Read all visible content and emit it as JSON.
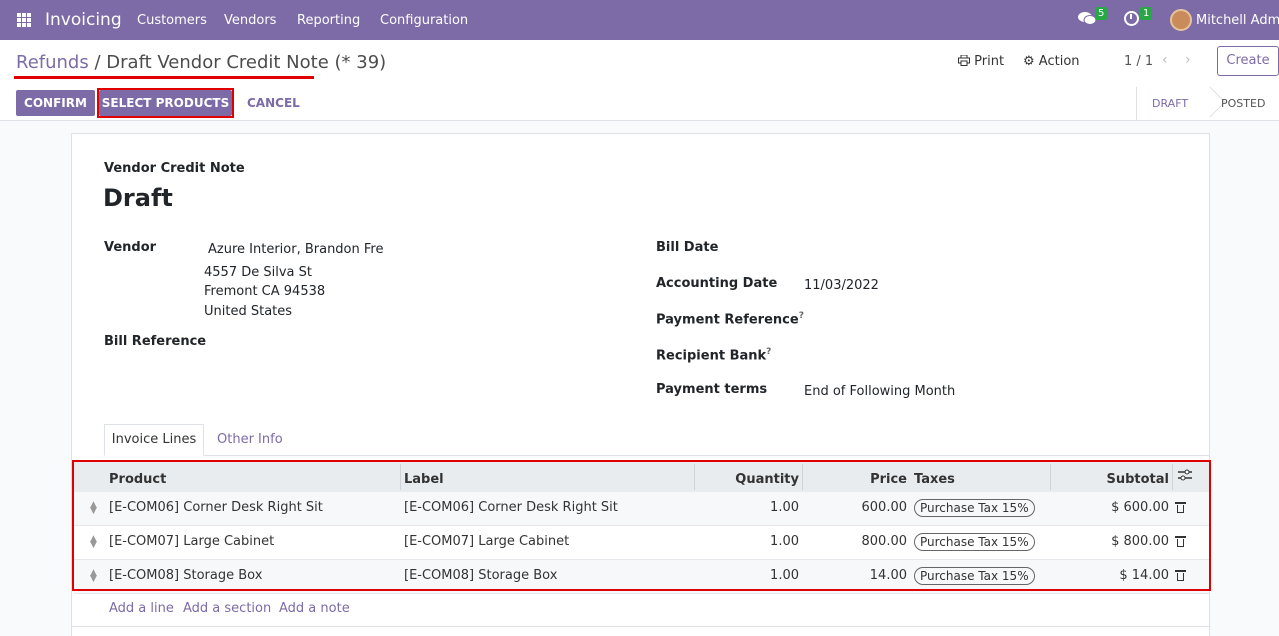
{
  "navbar": {
    "app_name": "Invoicing",
    "menu": [
      "Customers",
      "Vendors",
      "Reporting",
      "Configuration"
    ],
    "messages_count": "5",
    "activities_count": "1",
    "user_name": "Mitchell Admin"
  },
  "control_panel": {
    "breadcrumb_parent": "Refunds",
    "breadcrumb_separator": "/",
    "breadcrumb_current": "Draft Vendor Credit Note (* 39)",
    "print_label": "Print",
    "action_label": "Action",
    "pager": "1 / 1",
    "create_label": "Create",
    "confirm_label": "CONFIRM",
    "select_products_label": "SELECT PRODUCTS",
    "cancel_label": "CANCEL",
    "statuses": [
      "DRAFT",
      "POSTED"
    ]
  },
  "form": {
    "doc_type": "Vendor Credit Note",
    "doc_name": "Draft",
    "vendor_label": "Vendor",
    "vendor_name": "Azure Interior, Brandon Fre",
    "vendor_address": [
      "4557 De Silva St",
      "Fremont CA 94538",
      "United States"
    ],
    "bill_reference_label": "Bill Reference",
    "bill_date_label": "Bill Date",
    "bill_date_value": "",
    "accounting_date_label": "Accounting Date",
    "accounting_date_value": "11/03/2022",
    "payment_reference_label": "Payment Reference",
    "recipient_bank_label": "Recipient Bank",
    "help_mark": "?",
    "payment_terms_label": "Payment terms",
    "payment_terms_value": "End of Following Month"
  },
  "tabs": [
    "Invoice Lines",
    "Other Info"
  ],
  "table": {
    "headers": {
      "product": "Product",
      "label": "Label",
      "quantity": "Quantity",
      "price": "Price",
      "taxes": "Taxes",
      "subtotal": "Subtotal"
    },
    "rows": [
      {
        "product": "[E-COM06] Corner Desk Right Sit",
        "label": "[E-COM06] Corner Desk Right Sit",
        "quantity": "1.00",
        "price": "600.00",
        "tax": "Purchase Tax 15%",
        "subtotal": "$ 600.00"
      },
      {
        "product": "[E-COM07] Large Cabinet",
        "label": "[E-COM07] Large Cabinet",
        "quantity": "1.00",
        "price": "800.00",
        "tax": "Purchase Tax 15%",
        "subtotal": "$ 800.00"
      },
      {
        "product": "[E-COM08] Storage Box",
        "label": "[E-COM08] Storage Box",
        "quantity": "1.00",
        "price": "14.00",
        "tax": "Purchase Tax 15%",
        "subtotal": "$ 14.00"
      }
    ],
    "add_links": [
      "Add a line",
      "Add a section",
      "Add a note"
    ]
  },
  "colors": {
    "brand": "#7c6ba7",
    "highlight": "#e00000",
    "badge": "#28a745"
  },
  "icons": [
    "apps-grid-icon",
    "chat-icon",
    "clock-icon",
    "print-icon",
    "gear-icon",
    "chevron-left-icon",
    "chevron-right-icon",
    "sort-handle-icon",
    "trash-icon",
    "optional-columns-icon"
  ]
}
